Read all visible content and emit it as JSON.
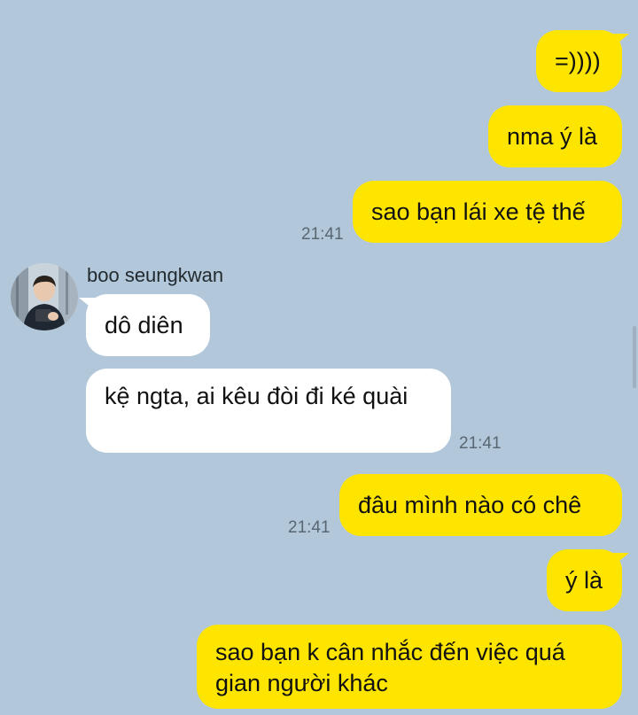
{
  "colors": {
    "chat_background": "#b2c7da",
    "my_bubble": "#fee500",
    "their_bubble": "#ffffff",
    "timestamp": "#596772"
  },
  "contact": {
    "name": "boo seungkwan",
    "avatar_icon": "profile-photo"
  },
  "messages": {
    "m1": {
      "text": "=))))",
      "sender": "me"
    },
    "m2": {
      "text": "nma ý là",
      "sender": "me"
    },
    "m3": {
      "text": "sao bạn lái xe tệ thế",
      "sender": "me",
      "time": "21:41"
    },
    "m4": {
      "text": "dô diên",
      "sender": "them"
    },
    "m5": {
      "text": "kệ ngta, ai kêu đòi đi ké quài",
      "sender": "them",
      "time": "21:41"
    },
    "m6": {
      "text": "đâu mình nào có chê",
      "sender": "me",
      "time": "21:41"
    },
    "m7": {
      "text": "ý là",
      "sender": "me"
    },
    "m8": {
      "text": "sao bạn k cân nhắc đến việc quá gian người khác",
      "sender": "me"
    }
  }
}
